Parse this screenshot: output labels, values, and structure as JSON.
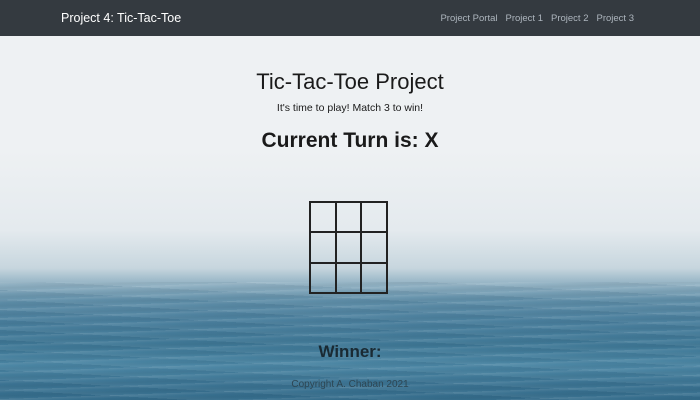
{
  "navbar": {
    "brand": "Project 4: Tic-Tac-Toe",
    "links": [
      "Project Portal",
      "Project 1",
      "Project 2",
      "Project 3"
    ]
  },
  "main": {
    "title": "Tic-Tac-Toe Project",
    "subtitle": "It's time to play! Match 3 to win!",
    "turn_label": "Current Turn is: X"
  },
  "board": {
    "cells": [
      "",
      "",
      "",
      "",
      "",
      "",
      "",
      "",
      ""
    ]
  },
  "winner_label": "Winner:",
  "footer": {
    "copyright": "Copyright A. Chaban 2021"
  },
  "colors": {
    "navbar_bg": "#343a40",
    "brand_text": "#ffffff",
    "nav_link": "#adb5bd",
    "ocean": "#3f7896"
  }
}
